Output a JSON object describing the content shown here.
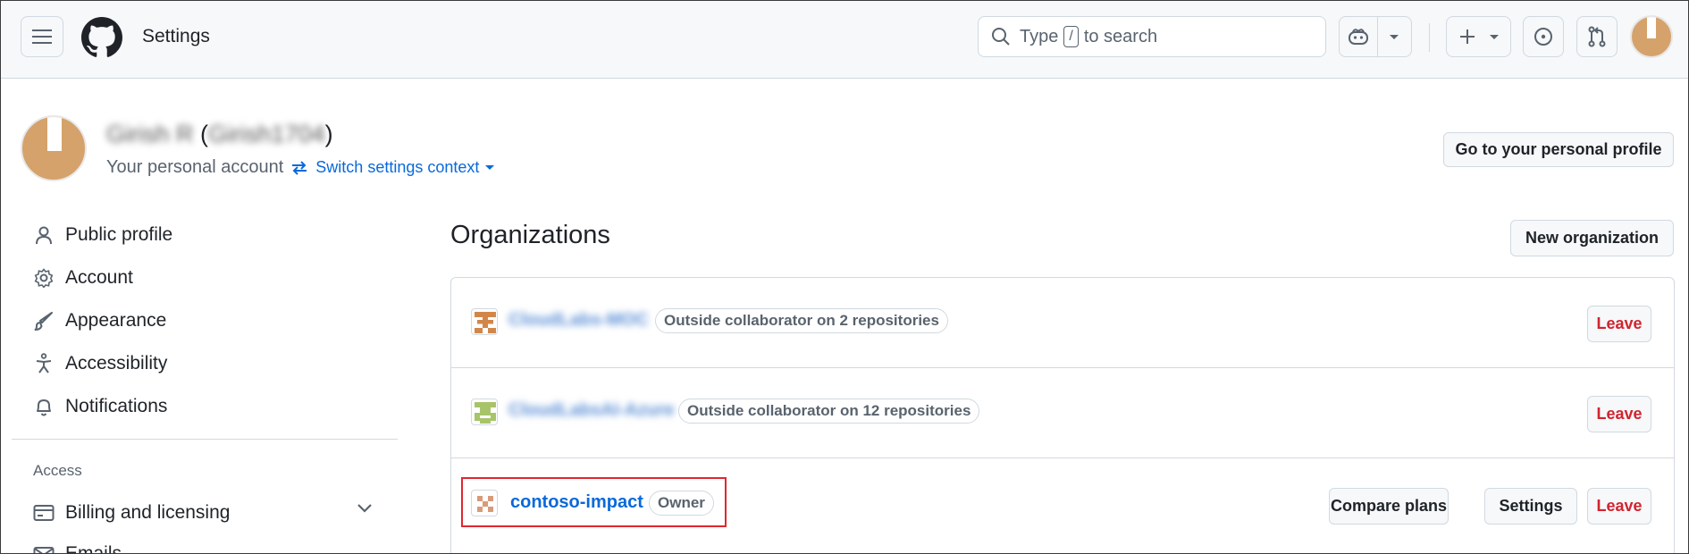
{
  "header": {
    "title": "Settings",
    "search": {
      "prefix": "Type",
      "key": "/",
      "suffix": "to search"
    }
  },
  "account": {
    "name": "Girish R",
    "handle": "Girish1704",
    "subtitle": "Your personal account",
    "switch_label": "Switch settings context",
    "profile_button": "Go to your personal profile"
  },
  "sidebar": {
    "items": [
      {
        "label": "Public profile",
        "icon": "person-icon"
      },
      {
        "label": "Account",
        "icon": "gear-icon"
      },
      {
        "label": "Appearance",
        "icon": "paintbrush-icon"
      },
      {
        "label": "Accessibility",
        "icon": "accessibility-icon"
      },
      {
        "label": "Notifications",
        "icon": "bell-icon"
      }
    ],
    "access_heading": "Access",
    "access_items": [
      {
        "label": "Billing and licensing",
        "icon": "credit-card-icon"
      },
      {
        "label": "Emails",
        "icon": "mail-icon"
      }
    ]
  },
  "main": {
    "title": "Organizations",
    "new_org_button": "New organization",
    "orgs": [
      {
        "name": "CloudLabs-MOC",
        "badge": "Outside collaborator on 2 repositories",
        "leave": "Leave",
        "avatar_color": "#d2874a"
      },
      {
        "name": "CloudLabsAI-Azure",
        "badge": "Outside collaborator on 12 repositories",
        "leave": "Leave",
        "avatar_color": "#a8c46a"
      },
      {
        "name": "contoso-impact",
        "badge": "Owner",
        "compare": "Compare plans",
        "settings": "Settings",
        "leave": "Leave",
        "avatar_color": "#d99a7a"
      }
    ]
  },
  "colors": {
    "accent": "#0969da",
    "danger": "#d1242f",
    "highlight": "#e0272f"
  }
}
